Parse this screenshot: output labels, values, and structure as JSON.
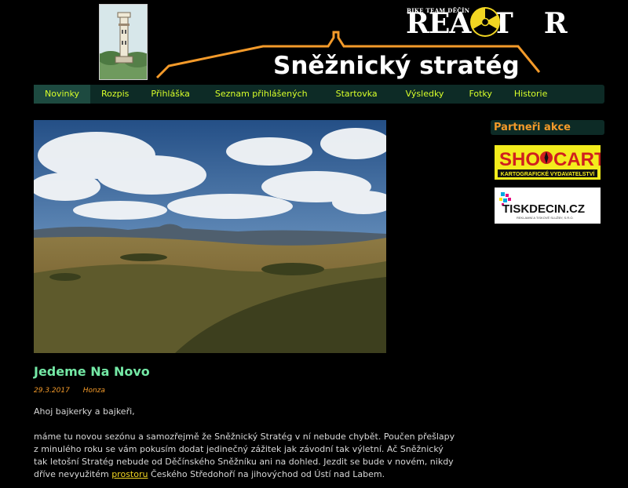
{
  "header": {
    "brand_small": "BIKE TEAM DĚČÍN",
    "brand_big_left": "REACT",
    "brand_big_right": "R",
    "site_title": "Sněžnický stratég"
  },
  "nav": {
    "items": [
      "Novinky",
      "Rozpis",
      "Přihláška",
      "Seznam přihlášených",
      "Startovka",
      "Výsledky",
      "Fotky",
      "Historie"
    ],
    "active": "Novinky"
  },
  "article": {
    "title": "Jedeme Na Novo",
    "date": "29.3.2017",
    "author": "Honza",
    "greeting": "Ahoj bajkerky a bajkeři,",
    "body_before_link": "máme tu novou sezónu a samozřejmě že Sněžnický Stratég v ní nebude chybět. Poučen přešlapy z minulého roku se vám pokusím dodat jedinečný zážitek jak závodní tak výletní. Ač Sněžnický tak letošní Stratég nebude od Děčínského Sněžníku ani na dohled. Jezdit se bude v novém, nikdy dříve nevyužitém ",
    "link_text": "prostoru",
    "body_after_link": " Českého Středohoří na jihovýchod od Ústí nad Labem."
  },
  "sidebar": {
    "title": "Partneři akce",
    "partners": [
      {
        "name_left": "SHO",
        "name_right": "CART",
        "tagline": "KARTOGRAFICKÉ VYDAVATELSTVÍ"
      },
      {
        "name": "TISKDECIN.CZ",
        "tagline": "REKLAMNÍ A TISKOVÉ SLUŽBY, S.R.O."
      }
    ]
  },
  "colors": {
    "background": "#000000",
    "nav_bg": "#0d2b26",
    "nav_text": "#d8ff2a",
    "accent_orange": "#f39a2a",
    "article_title": "#74e8a5",
    "link": "#f2d622"
  }
}
